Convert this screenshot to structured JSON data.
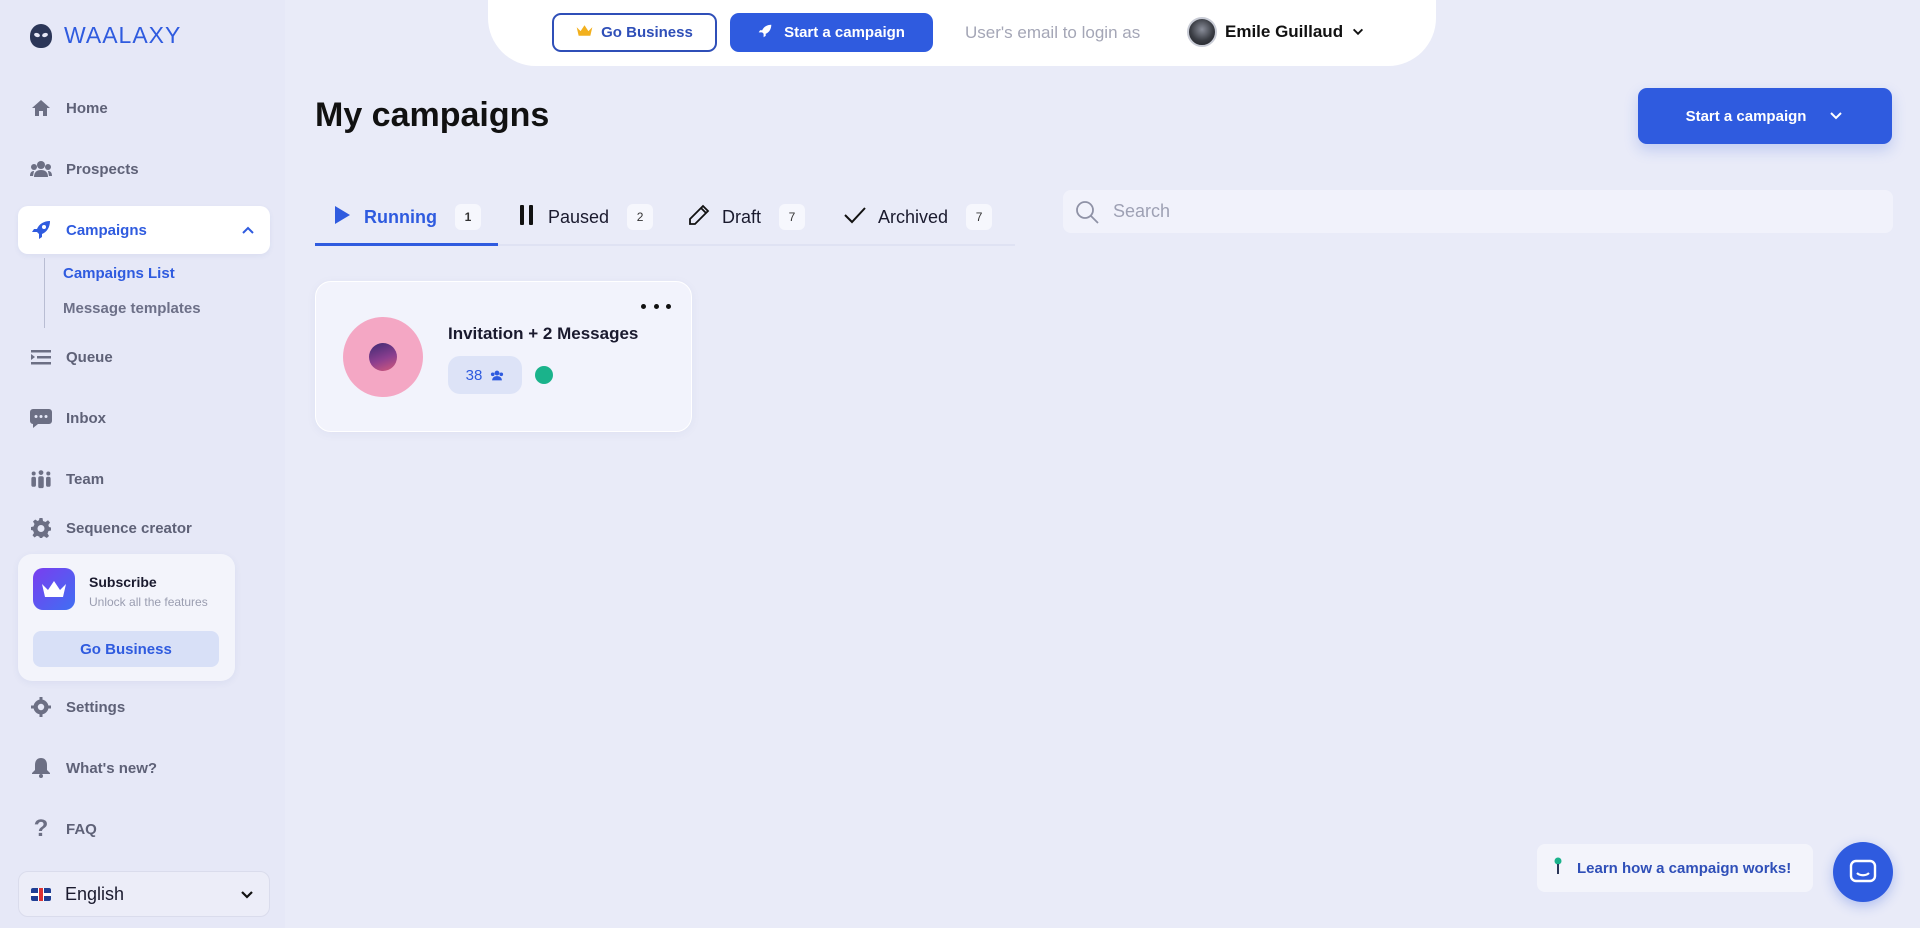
{
  "brand": {
    "name": "WAALAXY"
  },
  "sidebar": {
    "items": [
      {
        "label": "Home",
        "icon": "home-icon"
      },
      {
        "label": "Prospects",
        "icon": "users-icon"
      },
      {
        "label": "Campaigns",
        "icon": "rocket-icon",
        "active": true
      },
      {
        "label": "Queue",
        "icon": "queue-icon"
      },
      {
        "label": "Inbox",
        "icon": "chat-icon"
      },
      {
        "label": "Team",
        "icon": "team-icon"
      },
      {
        "label": "Sequence creator",
        "icon": "gear-icon"
      },
      {
        "label": "Settings",
        "icon": "gear-icon"
      },
      {
        "label": "What's new?",
        "icon": "bell-icon"
      },
      {
        "label": "FAQ",
        "icon": "question-icon"
      }
    ],
    "subitems": [
      {
        "label": "Campaigns List",
        "selected": true
      },
      {
        "label": "Message templates"
      }
    ],
    "subscribe": {
      "title": "Subscribe",
      "subtitle": "Unlock all the features",
      "button": "Go Business"
    },
    "language": {
      "label": "English",
      "flag": "uk-flag-icon"
    }
  },
  "topbar": {
    "go_business": "Go Business",
    "start_campaign": "Start a campaign",
    "login_as_placeholder": "User's email to login as",
    "user_name": "Emile Guillaud"
  },
  "main": {
    "title": "My campaigns",
    "start_campaign": "Start a campaign",
    "tabs": [
      {
        "label": "Running",
        "count": "1",
        "icon": "play-icon",
        "active": true
      },
      {
        "label": "Paused",
        "count": "2",
        "icon": "pause-icon"
      },
      {
        "label": "Draft",
        "count": "7",
        "icon": "pencil-icon"
      },
      {
        "label": "Archived",
        "count": "7",
        "icon": "check-icon"
      }
    ],
    "search": {
      "placeholder": "Search"
    },
    "campaigns": [
      {
        "name": "Invitation + 2 Messages",
        "prospects": "38",
        "status_color": "#1ab38b"
      }
    ]
  },
  "help": {
    "learn": "Learn how a campaign works!"
  },
  "colors": {
    "accent": "#2f5bdf",
    "background": "#e9ebf8",
    "status_running": "#1ab38b"
  }
}
